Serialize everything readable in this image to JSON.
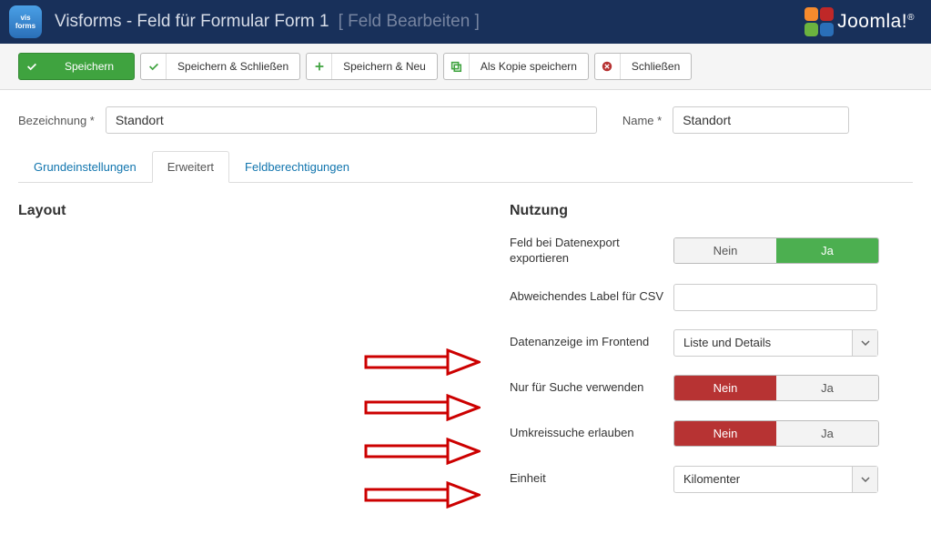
{
  "header": {
    "app_icon_line1": "vis",
    "app_icon_line2": "forms",
    "title": "Visforms - Feld für Formular Form 1",
    "subtitle": "[ Feld Bearbeiten ]",
    "brand": "Joomla!"
  },
  "toolbar": {
    "save": "Speichern",
    "save_close": "Speichern & Schließen",
    "save_new": "Speichern & Neu",
    "save_copy": "Als Kopie speichern",
    "close": "Schließen"
  },
  "fields": {
    "bezeichnung_label": "Bezeichnung *",
    "bezeichnung_value": "Standort",
    "name_label": "Name *",
    "name_value": "Standort"
  },
  "tabs": {
    "basic": "Grundeinstellungen",
    "advanced": "Erweitert",
    "permissions": "Feldberechtigungen"
  },
  "sections": {
    "layout": "Layout",
    "usage": "Nutzung"
  },
  "usage": {
    "export_label": "Feld bei Datenexport exportieren",
    "export_no": "Nein",
    "export_yes": "Ja",
    "csv_label": "Abweichendes Label für CSV",
    "csv_value": "",
    "frontend_label": "Datenanzeige im Frontend",
    "frontend_value": "Liste und Details",
    "search_label": "Nur für Suche verwenden",
    "search_no": "Nein",
    "search_yes": "Ja",
    "radius_label": "Umkreissuche erlauben",
    "radius_no": "Nein",
    "radius_yes": "Ja",
    "unit_label": "Einheit",
    "unit_value": "Kilomenter"
  }
}
